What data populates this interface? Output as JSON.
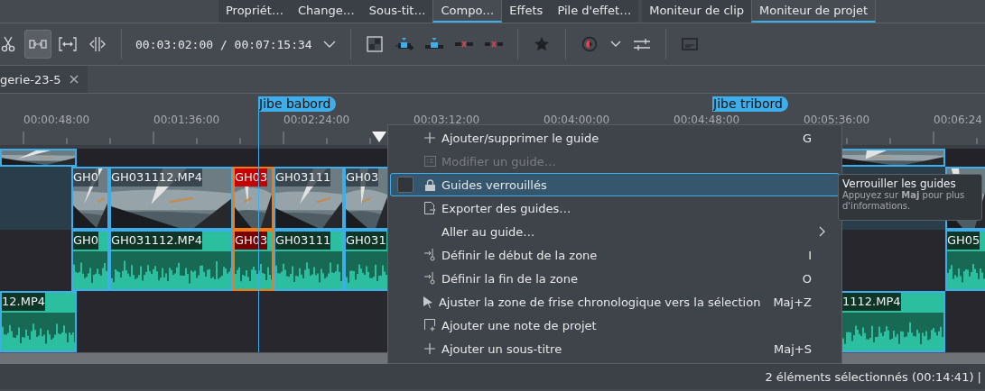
{
  "tab_groups": [
    {
      "tabs": [
        {
          "label": "Propriét…",
          "selected": false
        },
        {
          "label": "Change…",
          "selected": false
        },
        {
          "label": "Sous-tit…",
          "selected": false
        },
        {
          "label": "Compo…",
          "selected": true
        },
        {
          "label": "Effets",
          "selected": false
        },
        {
          "label": "Pile d'effet…",
          "selected": false
        }
      ]
    },
    {
      "tabs": [
        {
          "label": "Moniteur de clip",
          "selected": false
        },
        {
          "label": "Moniteur de projet",
          "selected": true
        }
      ]
    }
  ],
  "toolbar": {
    "edit_tools": [
      {
        "selected": false
      },
      {
        "selected": true
      },
      {
        "selected": false
      },
      {
        "selected": false
      }
    ],
    "timecode": "00:03:02:00 / 00:07:15:34"
  },
  "document_tab": {
    "title": "gerie-23-5"
  },
  "ruler": {
    "labels": [
      "00:00:48:00",
      "00:01:36:00",
      "00:02:24:00",
      "00:03:12:00",
      "00:04:00:00",
      "00:04:48:00",
      "00:05:36:00",
      "00:06:24"
    ],
    "guides": [
      {
        "label": "Jibe babord"
      },
      {
        "label": "Jibe tribord"
      }
    ]
  },
  "tracks": [
    {
      "kind": "video",
      "clips": [
        {
          "selected": false
        },
        {
          "selected": false
        }
      ]
    },
    {
      "kind": "video",
      "clips": [
        {
          "label": "GH0",
          "selected": false
        },
        {
          "label": "GH031112.MP4",
          "selected": false
        },
        {
          "label": "GH03",
          "selected": true
        },
        {
          "label": "GH03111",
          "selected": false
        },
        {
          "label": "GH03",
          "selected": false
        },
        {
          "selected": false
        }
      ]
    },
    {
      "kind": "audio",
      "clips": [
        {
          "label": "GH0",
          "selected": false
        },
        {
          "label": "GH031112.MP4",
          "selected": false
        },
        {
          "label": "GH03",
          "selected": true
        },
        {
          "label": "GH03111",
          "selected": false
        },
        {
          "label": "GH031",
          "selected": false
        },
        {
          "label": "GH05",
          "selected": false
        }
      ]
    },
    {
      "kind": "audio",
      "clips": [
        {
          "label": "12.MP4",
          "selected": false
        },
        {
          "label": "1112.MP4",
          "selected": false
        }
      ]
    }
  ],
  "context_menu": {
    "items": [
      {
        "kind": "action",
        "label": "Ajouter/supprimer le guide",
        "shortcut": "G",
        "disabled": false,
        "selected": false
      },
      {
        "kind": "action",
        "label": "Modifier un guide…",
        "disabled": true,
        "selected": false
      },
      {
        "kind": "check",
        "label": "Guides verrouillés",
        "checked": false,
        "disabled": false,
        "selected": true
      },
      {
        "kind": "action",
        "label": "Exporter des guides…",
        "disabled": false,
        "selected": false
      },
      {
        "kind": "submenu",
        "label": "Aller au guide…",
        "disabled": false,
        "selected": false
      },
      {
        "kind": "action",
        "label": "Définir le début de la zone",
        "shortcut": "I",
        "disabled": false,
        "selected": false
      },
      {
        "kind": "action",
        "label": "Définir la fin de la zone",
        "shortcut": "O",
        "disabled": false,
        "selected": false
      },
      {
        "kind": "action",
        "label": "Ajuster la zone de frise chronologique vers la sélection",
        "shortcut": "Maj+Z",
        "disabled": false,
        "selected": false
      },
      {
        "kind": "action",
        "label": "Ajouter une note de projet",
        "disabled": false,
        "selected": false
      },
      {
        "kind": "action",
        "label": "Ajouter un sous-titre",
        "shortcut": "Maj+S",
        "disabled": false,
        "selected": false
      }
    ]
  },
  "tooltip": {
    "title": "Verrouiller les guides",
    "text": "Appuyez sur **Maj** pour plus d'informations."
  },
  "status_bar": {
    "text": "2 éléments sélectionnés (00:14:41) |"
  }
}
